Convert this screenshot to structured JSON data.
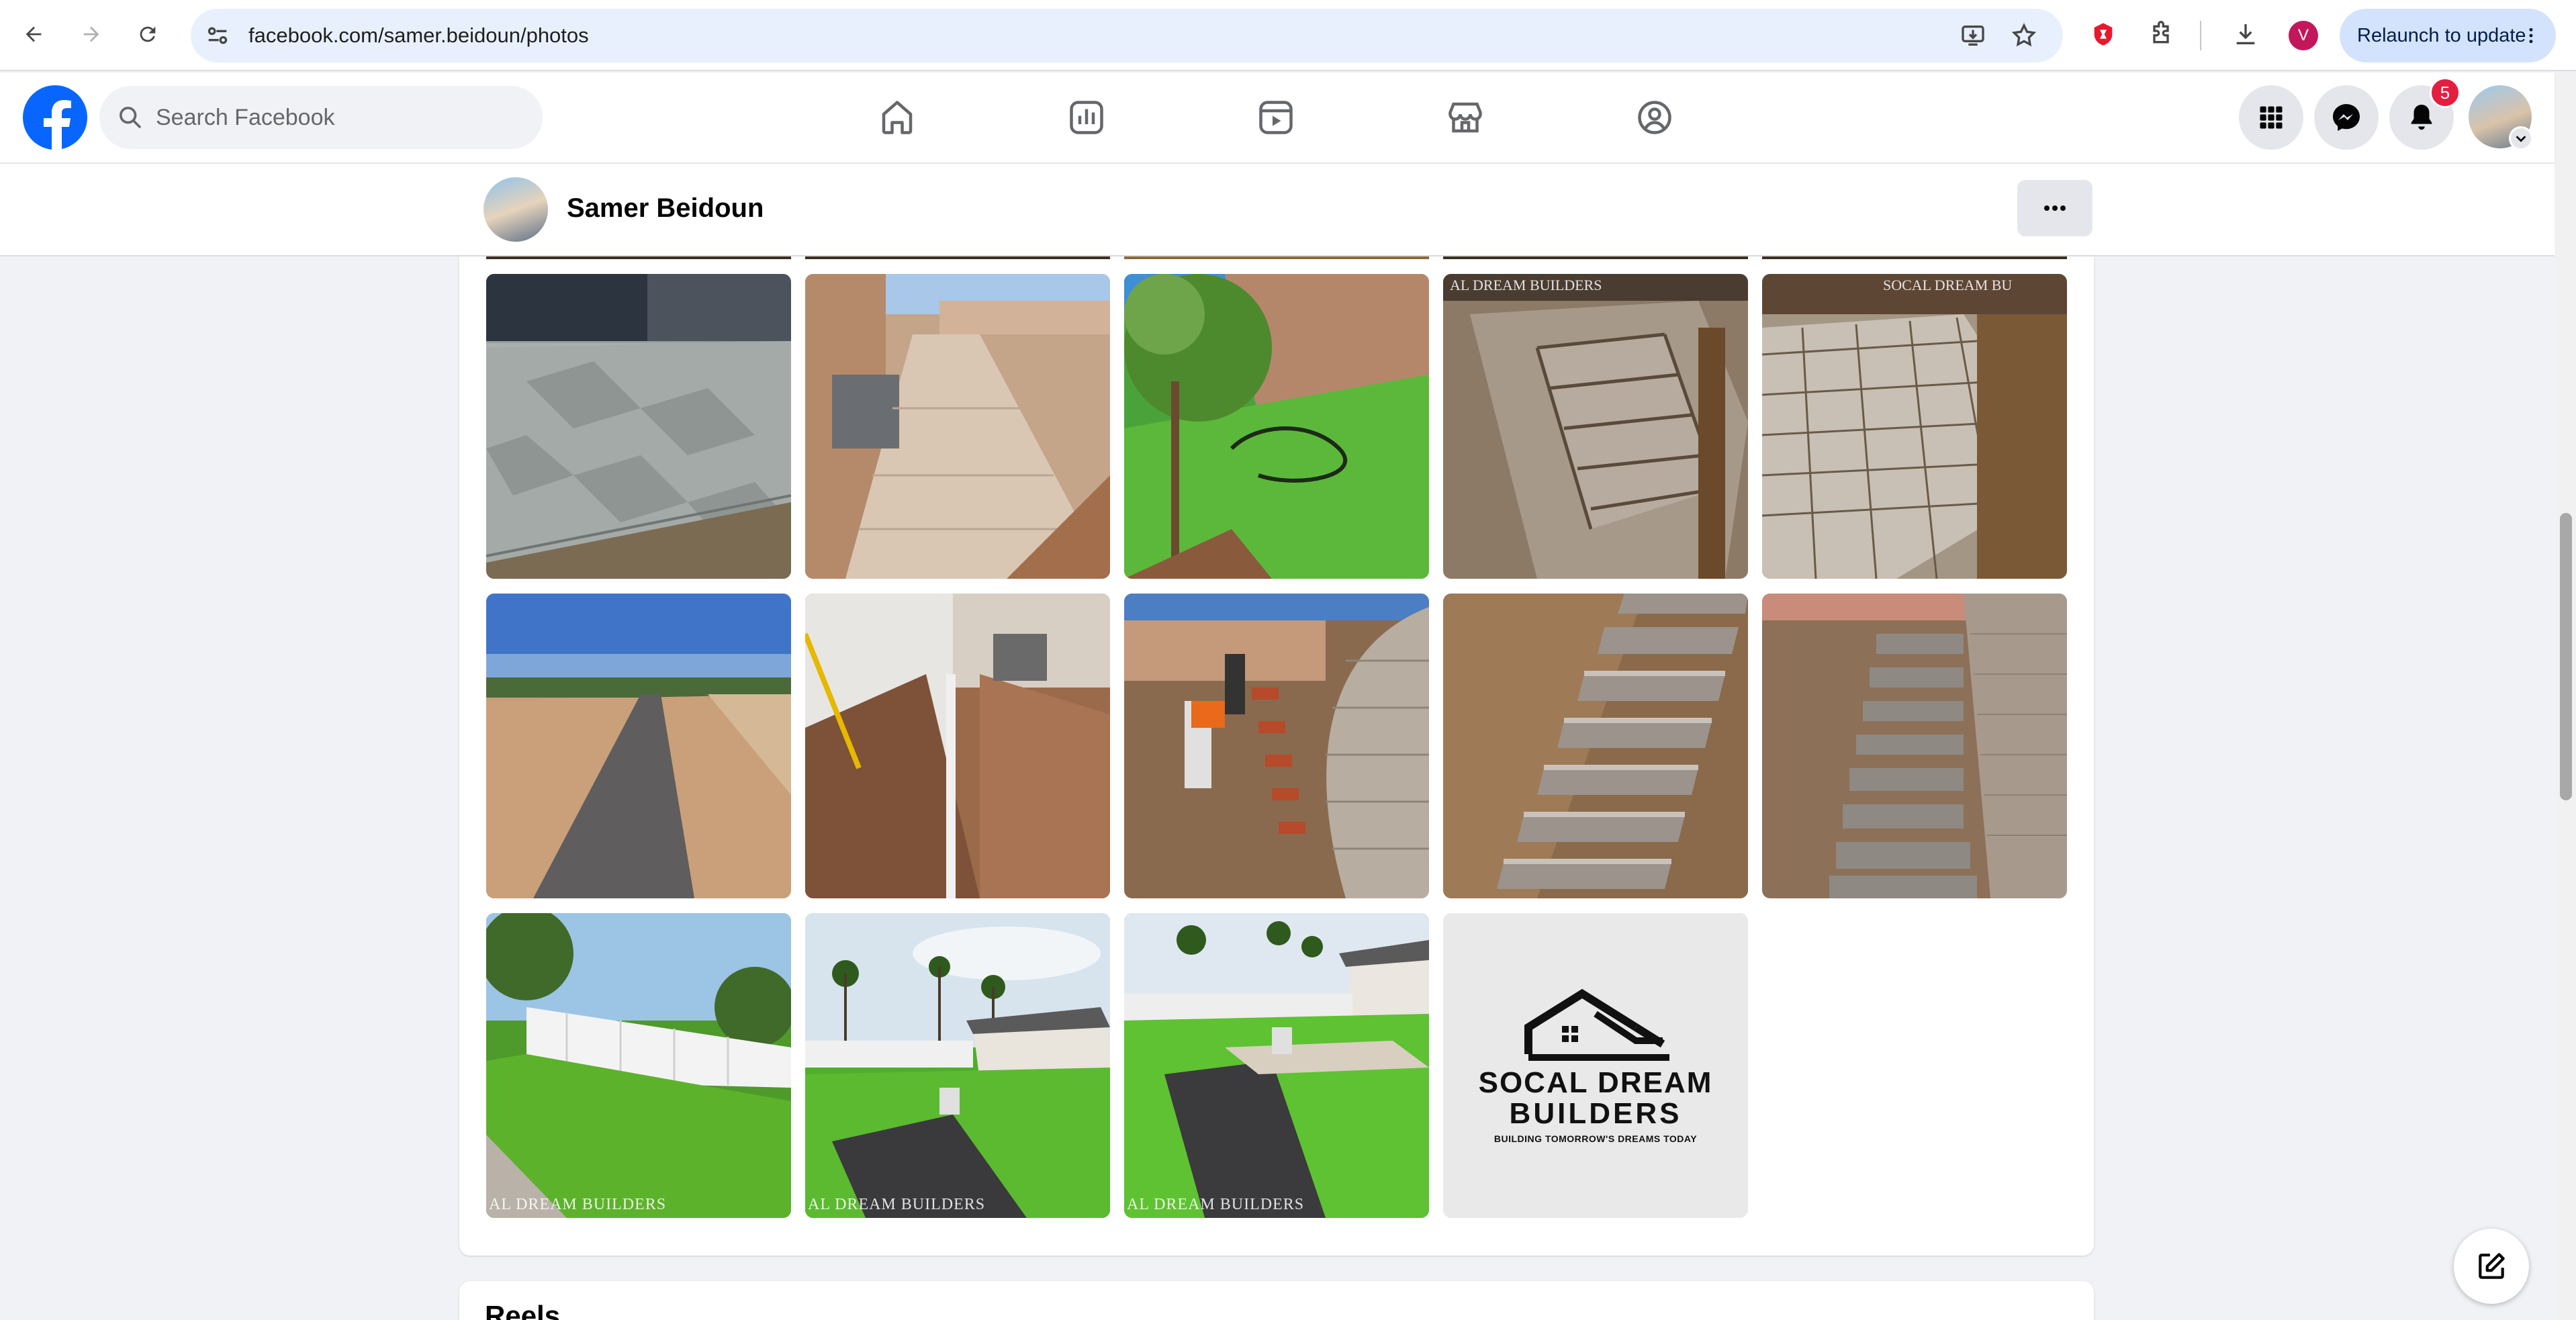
{
  "browser": {
    "url": "facebook.com/samer.beidoun/photos",
    "profile_initial": "V",
    "relaunch_label": "Relaunch to update"
  },
  "facebook": {
    "search_placeholder": "Search Facebook",
    "notification_count": "5"
  },
  "profile": {
    "name": "Samer Beidoun"
  },
  "photos": {
    "watermark": "AL DREAM BUILDERS",
    "watermark_top_1": "AL DREAM BUILDERS",
    "watermark_top_2": "SOCAL DREAM BU",
    "logo": {
      "line1": "SOCAL DREAM",
      "line2": "BUILDERS",
      "tagline": "BUILDING TOMORROW'S DREAMS TODAY"
    }
  },
  "reels": {
    "title": "Reels"
  },
  "colors": {
    "fb_blue": "#0866ff",
    "badge_red": "#e41e3f",
    "page_bg": "#f0f2f5"
  }
}
